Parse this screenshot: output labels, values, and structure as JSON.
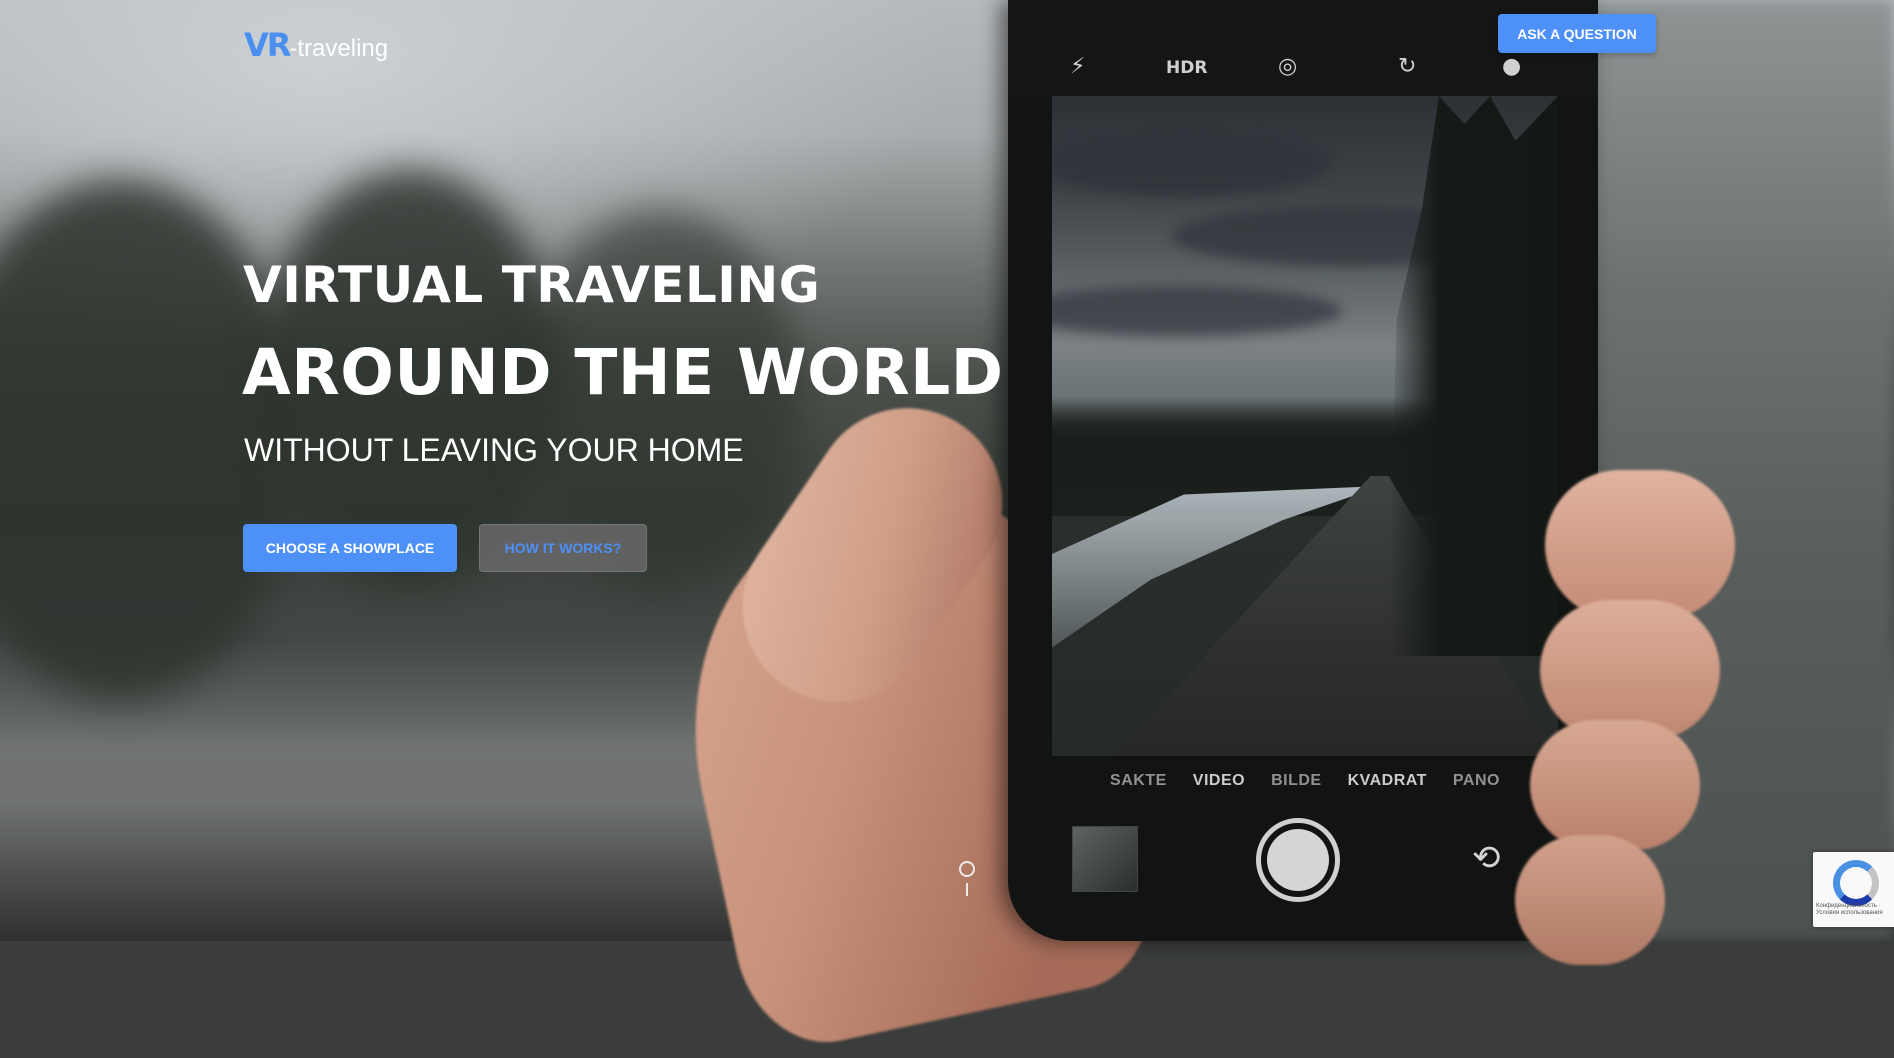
{
  "header": {
    "logo_vr": "VR",
    "logo_rest": "-traveling",
    "ask_label": "ASK A QUESTION"
  },
  "hero": {
    "title_line1": "VIRTUAL TRAVELING",
    "title_line2": "AROUND THE WORLD",
    "subtitle": "WITHOUT LEAVING YOUR HOME",
    "primary_button": "CHOOSE A SHOWPLACE",
    "secondary_button": "HOW IT WORKS?"
  },
  "phone": {
    "top_icons": [
      "flash-icon",
      "hdr-icon",
      "live-photo-off-icon",
      "timer-icon",
      "filters-icon"
    ],
    "hdr_label": "HDR",
    "modes": [
      "SAKTE",
      "VIDEO",
      "BILDE",
      "KVADRAT",
      "PANO"
    ]
  },
  "recaptcha": {
    "text": "Конфиденциальность · Условия использования"
  },
  "colors": {
    "accent": "#4d90f8",
    "logo_blue": "#4a8ff0",
    "secondary_button_bg": "#696868"
  }
}
